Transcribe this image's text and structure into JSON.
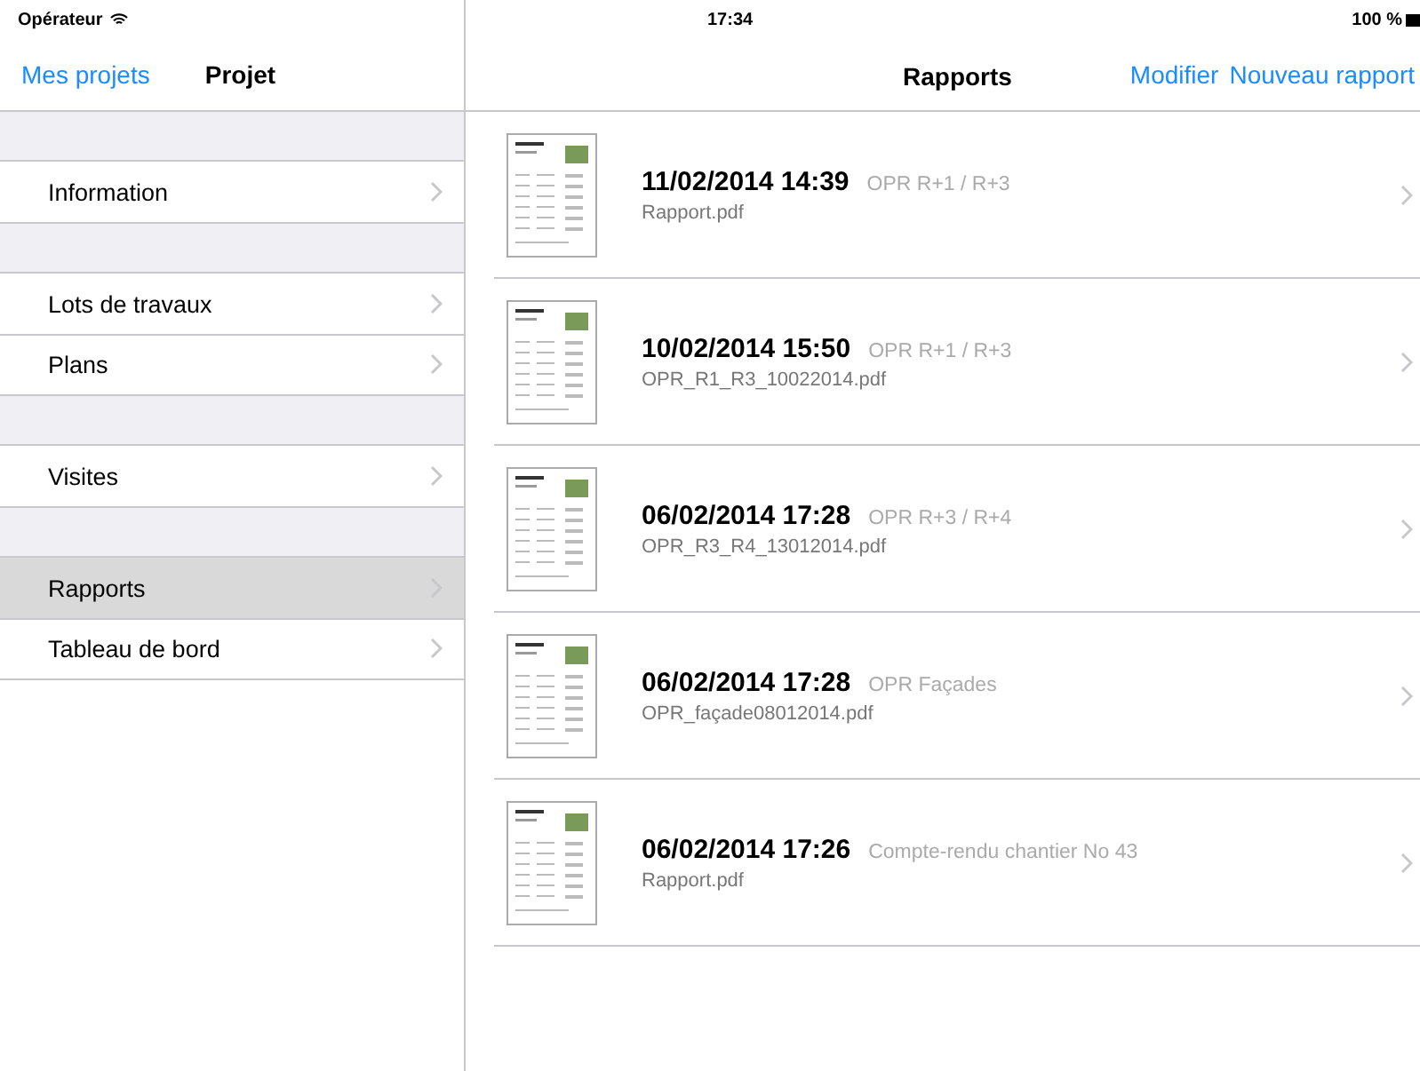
{
  "status_bar": {
    "carrier": "Opérateur",
    "time": "17:34",
    "battery": "100 %"
  },
  "sidebar": {
    "back": "Mes projets",
    "title": "Projet",
    "groups": [
      {
        "items": [
          {
            "label": "Information",
            "selected": false
          }
        ]
      },
      {
        "items": [
          {
            "label": "Lots de travaux",
            "selected": false
          },
          {
            "label": "Plans",
            "selected": false
          }
        ]
      },
      {
        "items": [
          {
            "label": "Visites",
            "selected": false
          }
        ]
      },
      {
        "items": [
          {
            "label": "Rapports",
            "selected": true
          },
          {
            "label": "Tableau de bord",
            "selected": false
          }
        ]
      }
    ]
  },
  "main": {
    "title": "Rapports",
    "actions": [
      "Modifier",
      "Nouveau rapport"
    ],
    "reports": [
      {
        "date": "11/02/2014 14:39",
        "name": "OPR R+1 / R+3",
        "file": "Rapport.pdf"
      },
      {
        "date": "10/02/2014 15:50",
        "name": "OPR R+1 / R+3",
        "file": "OPR_R1_R3_10022014.pdf"
      },
      {
        "date": "06/02/2014 17:28",
        "name": "OPR R+3 / R+4",
        "file": "OPR_R3_R4_13012014.pdf"
      },
      {
        "date": "06/02/2014 17:28",
        "name": "OPR Façades",
        "file": "OPR_façade08012014.pdf"
      },
      {
        "date": "06/02/2014 17:26",
        "name": "Compte-rendu chantier No 43",
        "file": "Rapport.pdf"
      }
    ]
  }
}
